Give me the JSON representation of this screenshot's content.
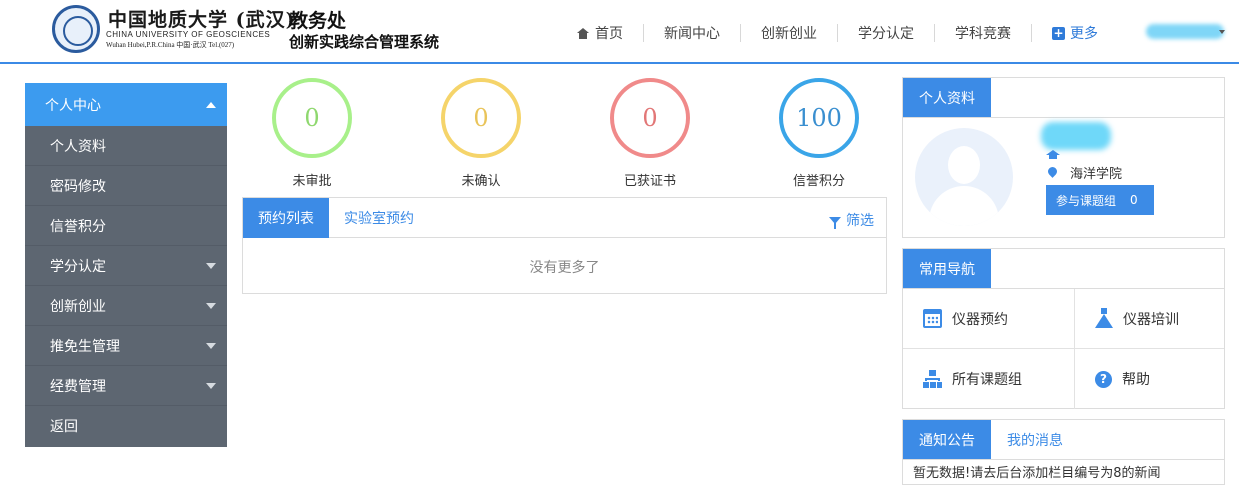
{
  "header": {
    "uni_cn": "中国地质大学 (武汉)",
    "uni_en": "CHINA  UNIVERSITY  OF  GEOSCIENCES",
    "uni_addr": "Wuhan  Hubei,P.R.China  中国·武汉  Tel.(027)",
    "office": "教务处",
    "system": "创新实践综合管理系统"
  },
  "topnav": {
    "home": "首页",
    "news": "新闻中心",
    "innovation": "创新创业",
    "credit": "学分认定",
    "competition": "学科竞赛",
    "more": "更多"
  },
  "sidebar": {
    "head": "个人中心",
    "items": [
      "个人资料",
      "密码修改",
      "信誉积分",
      "学分认定",
      "创新创业",
      "推免生管理",
      "经费管理",
      "返回"
    ]
  },
  "stats": [
    {
      "value": "0",
      "label": "未审批",
      "color": "#a8f08a",
      "text_color": "#8fd86f"
    },
    {
      "value": "0",
      "label": "未确认",
      "color": "#f5d46a",
      "text_color": "#e9c45a"
    },
    {
      "value": "0",
      "label": "已获证书",
      "color": "#f08a8a",
      "text_color": "#e27777"
    },
    {
      "value": "100",
      "label": "信誉积分",
      "color": "#3aa5e8",
      "text_color": "#3a8fd0"
    }
  ],
  "appointments": {
    "tab_active": "预约列表",
    "tab_lab": "实验室预约",
    "filter": "筛选",
    "empty": "没有更多了"
  },
  "profile": {
    "title": "个人资料",
    "college": "海洋学院",
    "group_label": "参与课题组",
    "group_count": "0"
  },
  "quicknav": {
    "title": "常用导航",
    "items": [
      "仪器预约",
      "仪器培训",
      "所有课题组",
      "帮助"
    ]
  },
  "notice": {
    "tab_active": "通知公告",
    "tab_messages": "我的消息",
    "text": "暂无数据!请去后台添加栏目编号为8的新闻"
  },
  "colors": {
    "accent": "#3c8be6",
    "sidebar_bg": "#5d6671",
    "sidebar_head": "#3c9bef"
  }
}
